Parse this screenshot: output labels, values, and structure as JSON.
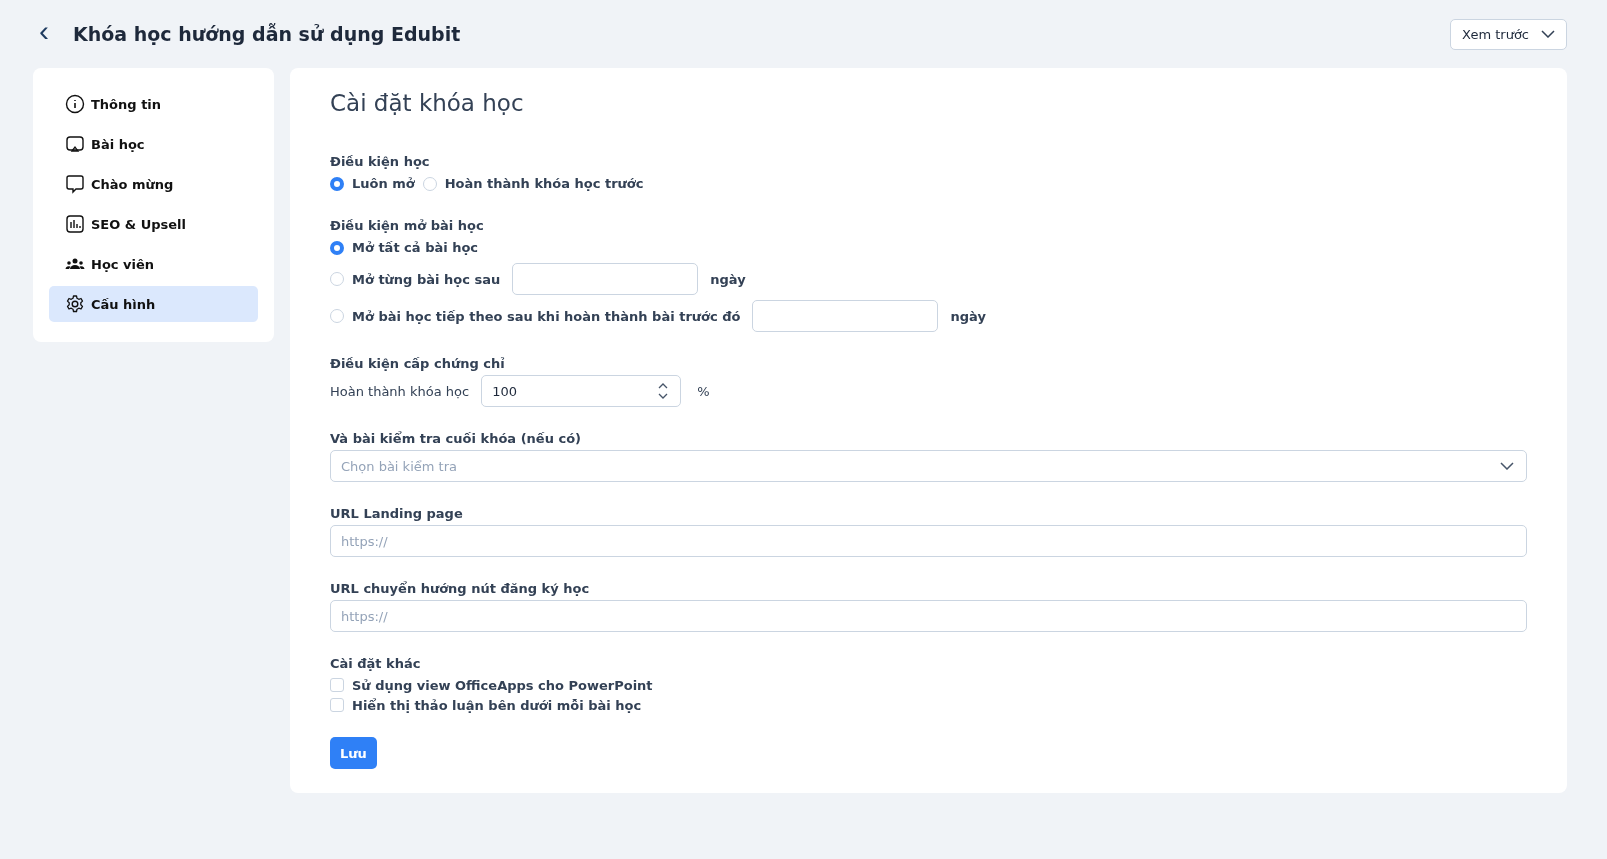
{
  "header": {
    "back": "‹",
    "title": "Khóa học hướng dẫn sử dụng Edubit",
    "preview_button": "Xem trước"
  },
  "sidebar": {
    "items": [
      {
        "kind": "info",
        "label": "Thông tin",
        "selected": false
      },
      {
        "kind": "lesson",
        "label": "Bài học",
        "selected": false
      },
      {
        "kind": "chat",
        "label": "Chào mừng",
        "selected": false
      },
      {
        "kind": "chart",
        "label": "SEO & Upsell",
        "selected": false
      },
      {
        "kind": "users",
        "label": "Học viên",
        "selected": false
      },
      {
        "kind": "gear",
        "label": "Cấu hình",
        "selected": true
      }
    ]
  },
  "settings": {
    "title": "Cài đặt khóa học",
    "study_condition": {
      "label": "Điều kiện học",
      "options": [
        {
          "label": "Luôn mở",
          "selected": true
        },
        {
          "label": "Hoàn thành khóa học trước",
          "selected": false
        }
      ]
    },
    "unlock_condition": {
      "label": "Điều kiện mở bài học",
      "options": [
        {
          "label": "Mở tất cả bài học",
          "selected": true
        },
        {
          "label": "Mở từng bài học sau",
          "selected": false,
          "suffix": "ngày"
        },
        {
          "label": "Mở bài học tiếp theo sau khi hoàn thành bài trước đó",
          "selected": false,
          "suffix": "ngày"
        }
      ]
    },
    "certificate": {
      "label": "Điều kiện cấp chứng chỉ",
      "field_label": "Hoàn thành khóa học",
      "value": "100",
      "unit": "%"
    },
    "final_test": {
      "label": "Và bài kiểm tra cuối khóa (nếu có)",
      "placeholder": "Chọn bài kiểm tra"
    },
    "landing_url": {
      "label": "URL Landing page",
      "placeholder": "https://"
    },
    "redirect_url": {
      "label": "URL chuyển hướng nút đăng ký học",
      "placeholder": "https://"
    },
    "other": {
      "label": "Cài đặt khác",
      "options": [
        {
          "label": "Sử dụng view OfficeApps cho PowerPoint",
          "checked": false
        },
        {
          "label": "Hiển thị thảo luận bên dưới mỗi bài học",
          "checked": false
        }
      ]
    },
    "save_button": "Lưu"
  }
}
